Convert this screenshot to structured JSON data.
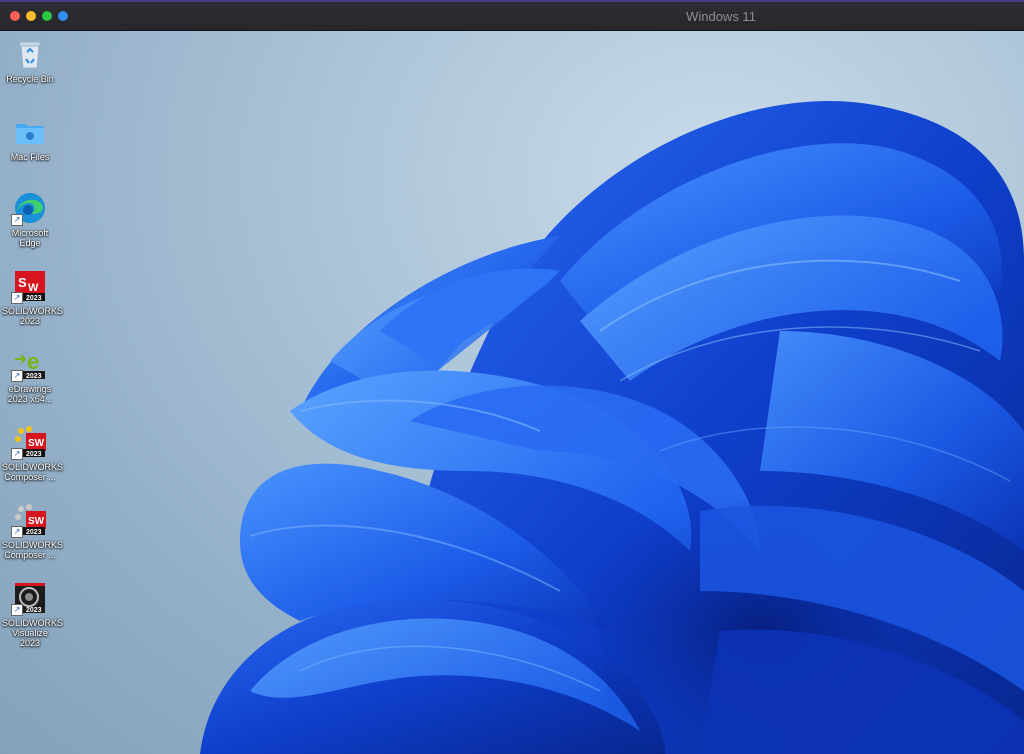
{
  "window": {
    "title": "Windows 11",
    "buttons": [
      {
        "name": "close",
        "color": "#fe5f57"
      },
      {
        "name": "minimize",
        "color": "#febc2e"
      },
      {
        "name": "zoom",
        "color": "#28c840"
      },
      {
        "name": "extra",
        "color": "#2f8df2"
      }
    ]
  },
  "desktop": {
    "wallpaper": "windows-11-bloom",
    "colors": {
      "bloom_dark": "#0a2fb0",
      "bloom_mid": "#1a55e6",
      "bloom_light": "#3f86ff",
      "background": "#b9cfe1"
    },
    "icons": [
      {
        "label": "Recycle Bin",
        "icon": "recycle-bin-icon",
        "shortcut": false
      },
      {
        "label": "Mac Files",
        "icon": "mac-folder-icon",
        "shortcut": false
      },
      {
        "label": "Microsoft Edge",
        "icon": "edge-icon",
        "shortcut": true
      },
      {
        "label": "SOLIDWORKS 2023",
        "icon": "solidworks-icon",
        "shortcut": true,
        "badge": "2023"
      },
      {
        "label": "eDrawings 2023 x64...",
        "icon": "edrawings-icon",
        "shortcut": true,
        "badge": "2023"
      },
      {
        "label": "SOLIDWORKS Composer ...",
        "icon": "solidworks-composer-icon",
        "shortcut": true,
        "badge": "2023"
      },
      {
        "label": "SOLIDWORKS Composer ...",
        "icon": "solidworks-composer-player-icon",
        "shortcut": true,
        "badge": "2023"
      },
      {
        "label": "SOLIDWORKS Visualize 2023",
        "icon": "solidworks-visualize-icon",
        "shortcut": true,
        "badge": "2023"
      }
    ]
  }
}
